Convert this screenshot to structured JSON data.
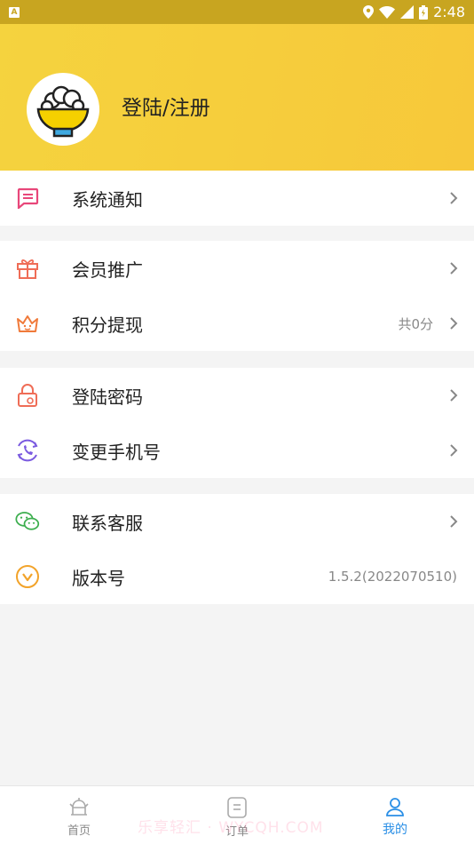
{
  "status_bar": {
    "time": "2:48"
  },
  "header": {
    "login_label": "登陆/注册"
  },
  "sections": [
    {
      "rows": [
        {
          "label": "系统通知",
          "icon": "message-icon"
        }
      ]
    },
    {
      "rows": [
        {
          "label": "会员推广",
          "icon": "gift-icon"
        },
        {
          "label": "积分提现",
          "icon": "crown-icon",
          "value": "共0分"
        }
      ]
    },
    {
      "rows": [
        {
          "label": "登陆密码",
          "icon": "lock-icon"
        },
        {
          "label": "变更手机号",
          "icon": "phone-icon"
        }
      ]
    },
    {
      "rows": [
        {
          "label": "联系客服",
          "icon": "wechat-icon"
        },
        {
          "label": "版本号",
          "icon": "version-icon",
          "value": "1.5.2(2022070510)"
        }
      ]
    }
  ],
  "tabbar": {
    "home": "首页",
    "orders": "订单",
    "mine": "我的",
    "active_color": "#2a8fe6"
  },
  "watermark": "乐享轻汇 · WYCQH.COM",
  "colors": {
    "header_start": "#f5d33e",
    "header_end": "#f7c83a",
    "status_bar": "#c8a520"
  }
}
